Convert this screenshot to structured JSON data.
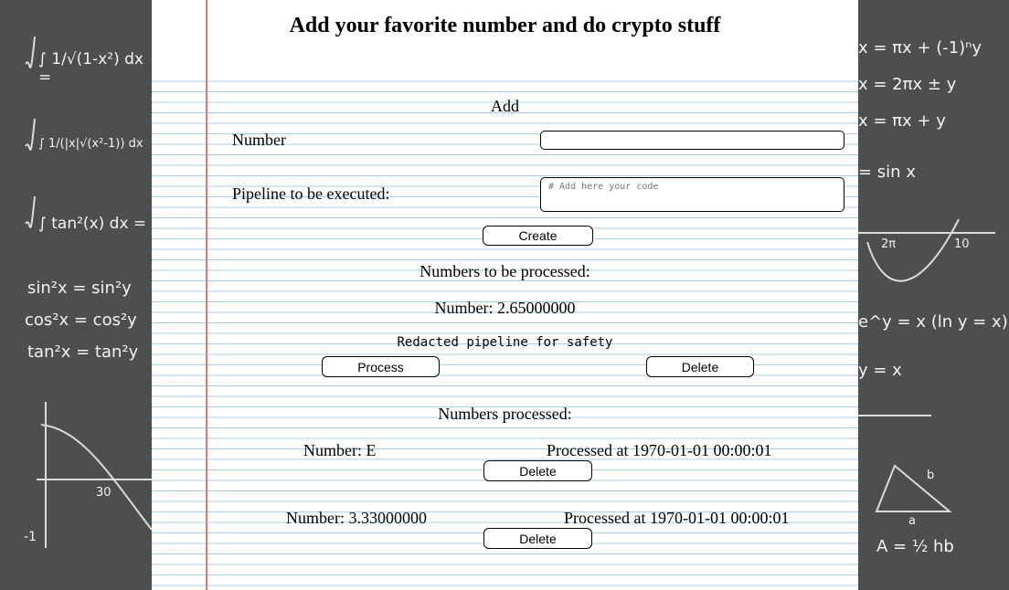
{
  "page": {
    "title": "Add your favorite number and do crypto stuff"
  },
  "add_form": {
    "heading": "Add",
    "number_label": "Number",
    "number_value": "",
    "pipeline_label": "Pipeline to be executed:",
    "pipeline_placeholder": "# Add here your code",
    "create_label": "Create"
  },
  "to_process": {
    "heading": "Numbers to be processed:",
    "items": [
      {
        "number": "Number: 2.65000000",
        "pipeline": "Redacted pipeline for safety",
        "process_label": "Process",
        "delete_label": "Delete"
      }
    ]
  },
  "processed": {
    "heading": "Numbers processed:",
    "items": [
      {
        "number": "Number: E",
        "processed_at": "Processed at 1970-01-01 00:00:01",
        "delete_label": "Delete"
      },
      {
        "number": "Number: 3.33000000",
        "processed_at": "Processed at 1970-01-01 00:00:01",
        "delete_label": "Delete"
      }
    ]
  },
  "colors": {
    "chalkboard": "#4e4e4e",
    "paper": "#ffffff",
    "ruled_line": "#a8cfe6",
    "margin_line": "#e07a7a"
  },
  "background": {
    "left_formulas": [
      "∫ 1/√(1-x²) dx =",
      "∫ 1/(|x|√(x²-1)) dx",
      "∫ tan²(x) dx =",
      "sin²x = sin²y",
      "cos²x = cos²y",
      "tan²x = tan²y",
      "30",
      "-1"
    ],
    "right_formulas": [
      "x = πx + (-1)ⁿy",
      "x = 2πx ± y",
      "x = πx + y",
      "= sin x",
      "2π",
      "10",
      "e^y = x (ln y = x)",
      "y = x",
      "a",
      "b",
      "A = ½ hb"
    ]
  }
}
